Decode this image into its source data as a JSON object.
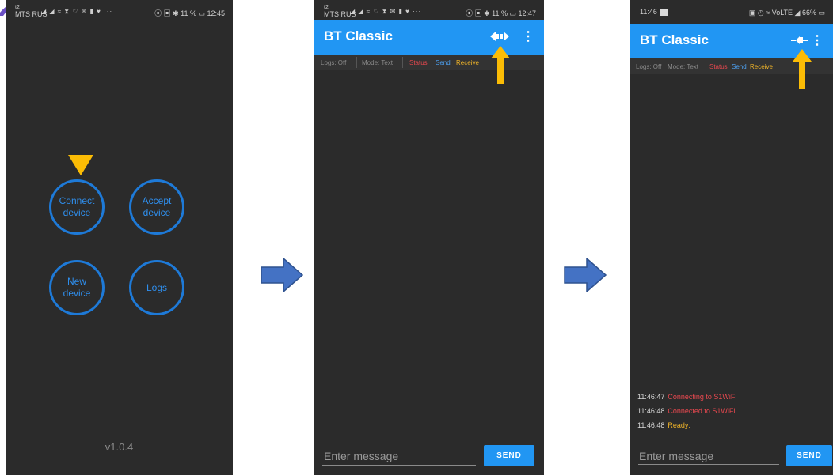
{
  "phone1": {
    "status": {
      "carrier_top": "t2",
      "carrier": "MTS RUS",
      "icons": "◢ ◢ ≈ ⧗ ♡ ✉ ▮ ♥ ···",
      "right": "⦿ ▣ ✱ 11 % ▭ 12:45"
    },
    "buttons": {
      "connect": "Connect\ndevice",
      "accept": "Accept\ndevice",
      "new_device": "New\ndevice",
      "logs": "Logs"
    },
    "version": "v1.0.4"
  },
  "phone2": {
    "status": {
      "carrier_top": "t2",
      "carrier": "MTS RUS",
      "icons": "◢ ◢ ≈ ♡ ⧗ ✉ ▮ ♥ ···",
      "right": "⦿ ▣ ✱ 11 % ▭ 12:47"
    },
    "title": "BT Classic",
    "menu": "⋮",
    "legend": {
      "logs": "Logs: Off",
      "mode": "Mode: Text",
      "status": "Status",
      "send": "Send",
      "receive": "Receive"
    },
    "input_placeholder": "Enter message",
    "send_label": "SEND"
  },
  "phone3": {
    "status": {
      "time": "11:46",
      "right": "▣ ◷ ≈ VoLTE ◢ 66% ▭"
    },
    "title": "BT Classic",
    "menu": "⋮",
    "legend": {
      "logs": "Logs: Off",
      "mode": "Mode: Text",
      "status": "Status",
      "send": "Send",
      "receive": "Receive"
    },
    "logs": [
      {
        "time": "11:46:47",
        "message": "Connecting to S1WiFi",
        "kind": "status"
      },
      {
        "time": "11:46:48",
        "message": "Connected to S1WiFi",
        "kind": "status"
      },
      {
        "time": "11:46:48",
        "message": "Ready:",
        "kind": "receive"
      }
    ],
    "input_placeholder": "Enter message",
    "send_label": "SEND"
  },
  "colors": {
    "accent": "#2196f3",
    "status": "#e8484f",
    "send": "#4ea3f5",
    "receive": "#f0b429",
    "marker": "#fbbc05",
    "flow_arrow": "#4472c4"
  },
  "icons": [
    "connect-plug-icon",
    "menu-dots-icon",
    "flow-arrow-icon",
    "marker-arrow-icon"
  ]
}
